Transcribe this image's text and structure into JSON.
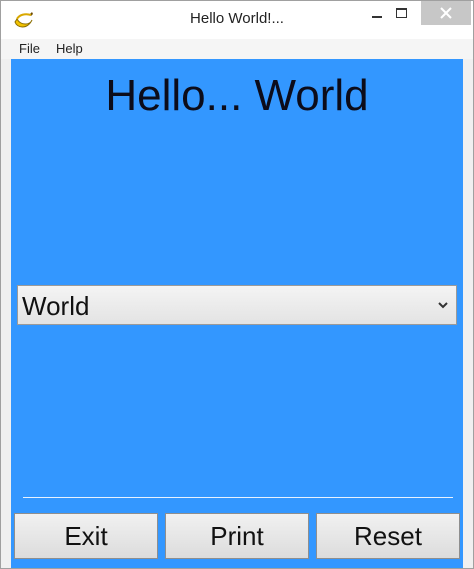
{
  "window": {
    "title": "Hello World!..."
  },
  "menu": {
    "items": [
      "File",
      "Help"
    ]
  },
  "main": {
    "headline": "Hello... World",
    "select": {
      "value": "World"
    }
  },
  "buttons": {
    "exit": "Exit",
    "print": "Print",
    "reset": "Reset"
  },
  "colors": {
    "client_background": "#3397ff",
    "close_button": "#c7c7c7"
  },
  "icons": {
    "app": "banana-icon",
    "minimize": "minimize-icon",
    "maximize": "maximize-icon",
    "close": "close-icon",
    "dropdown": "chevron-down-icon"
  }
}
